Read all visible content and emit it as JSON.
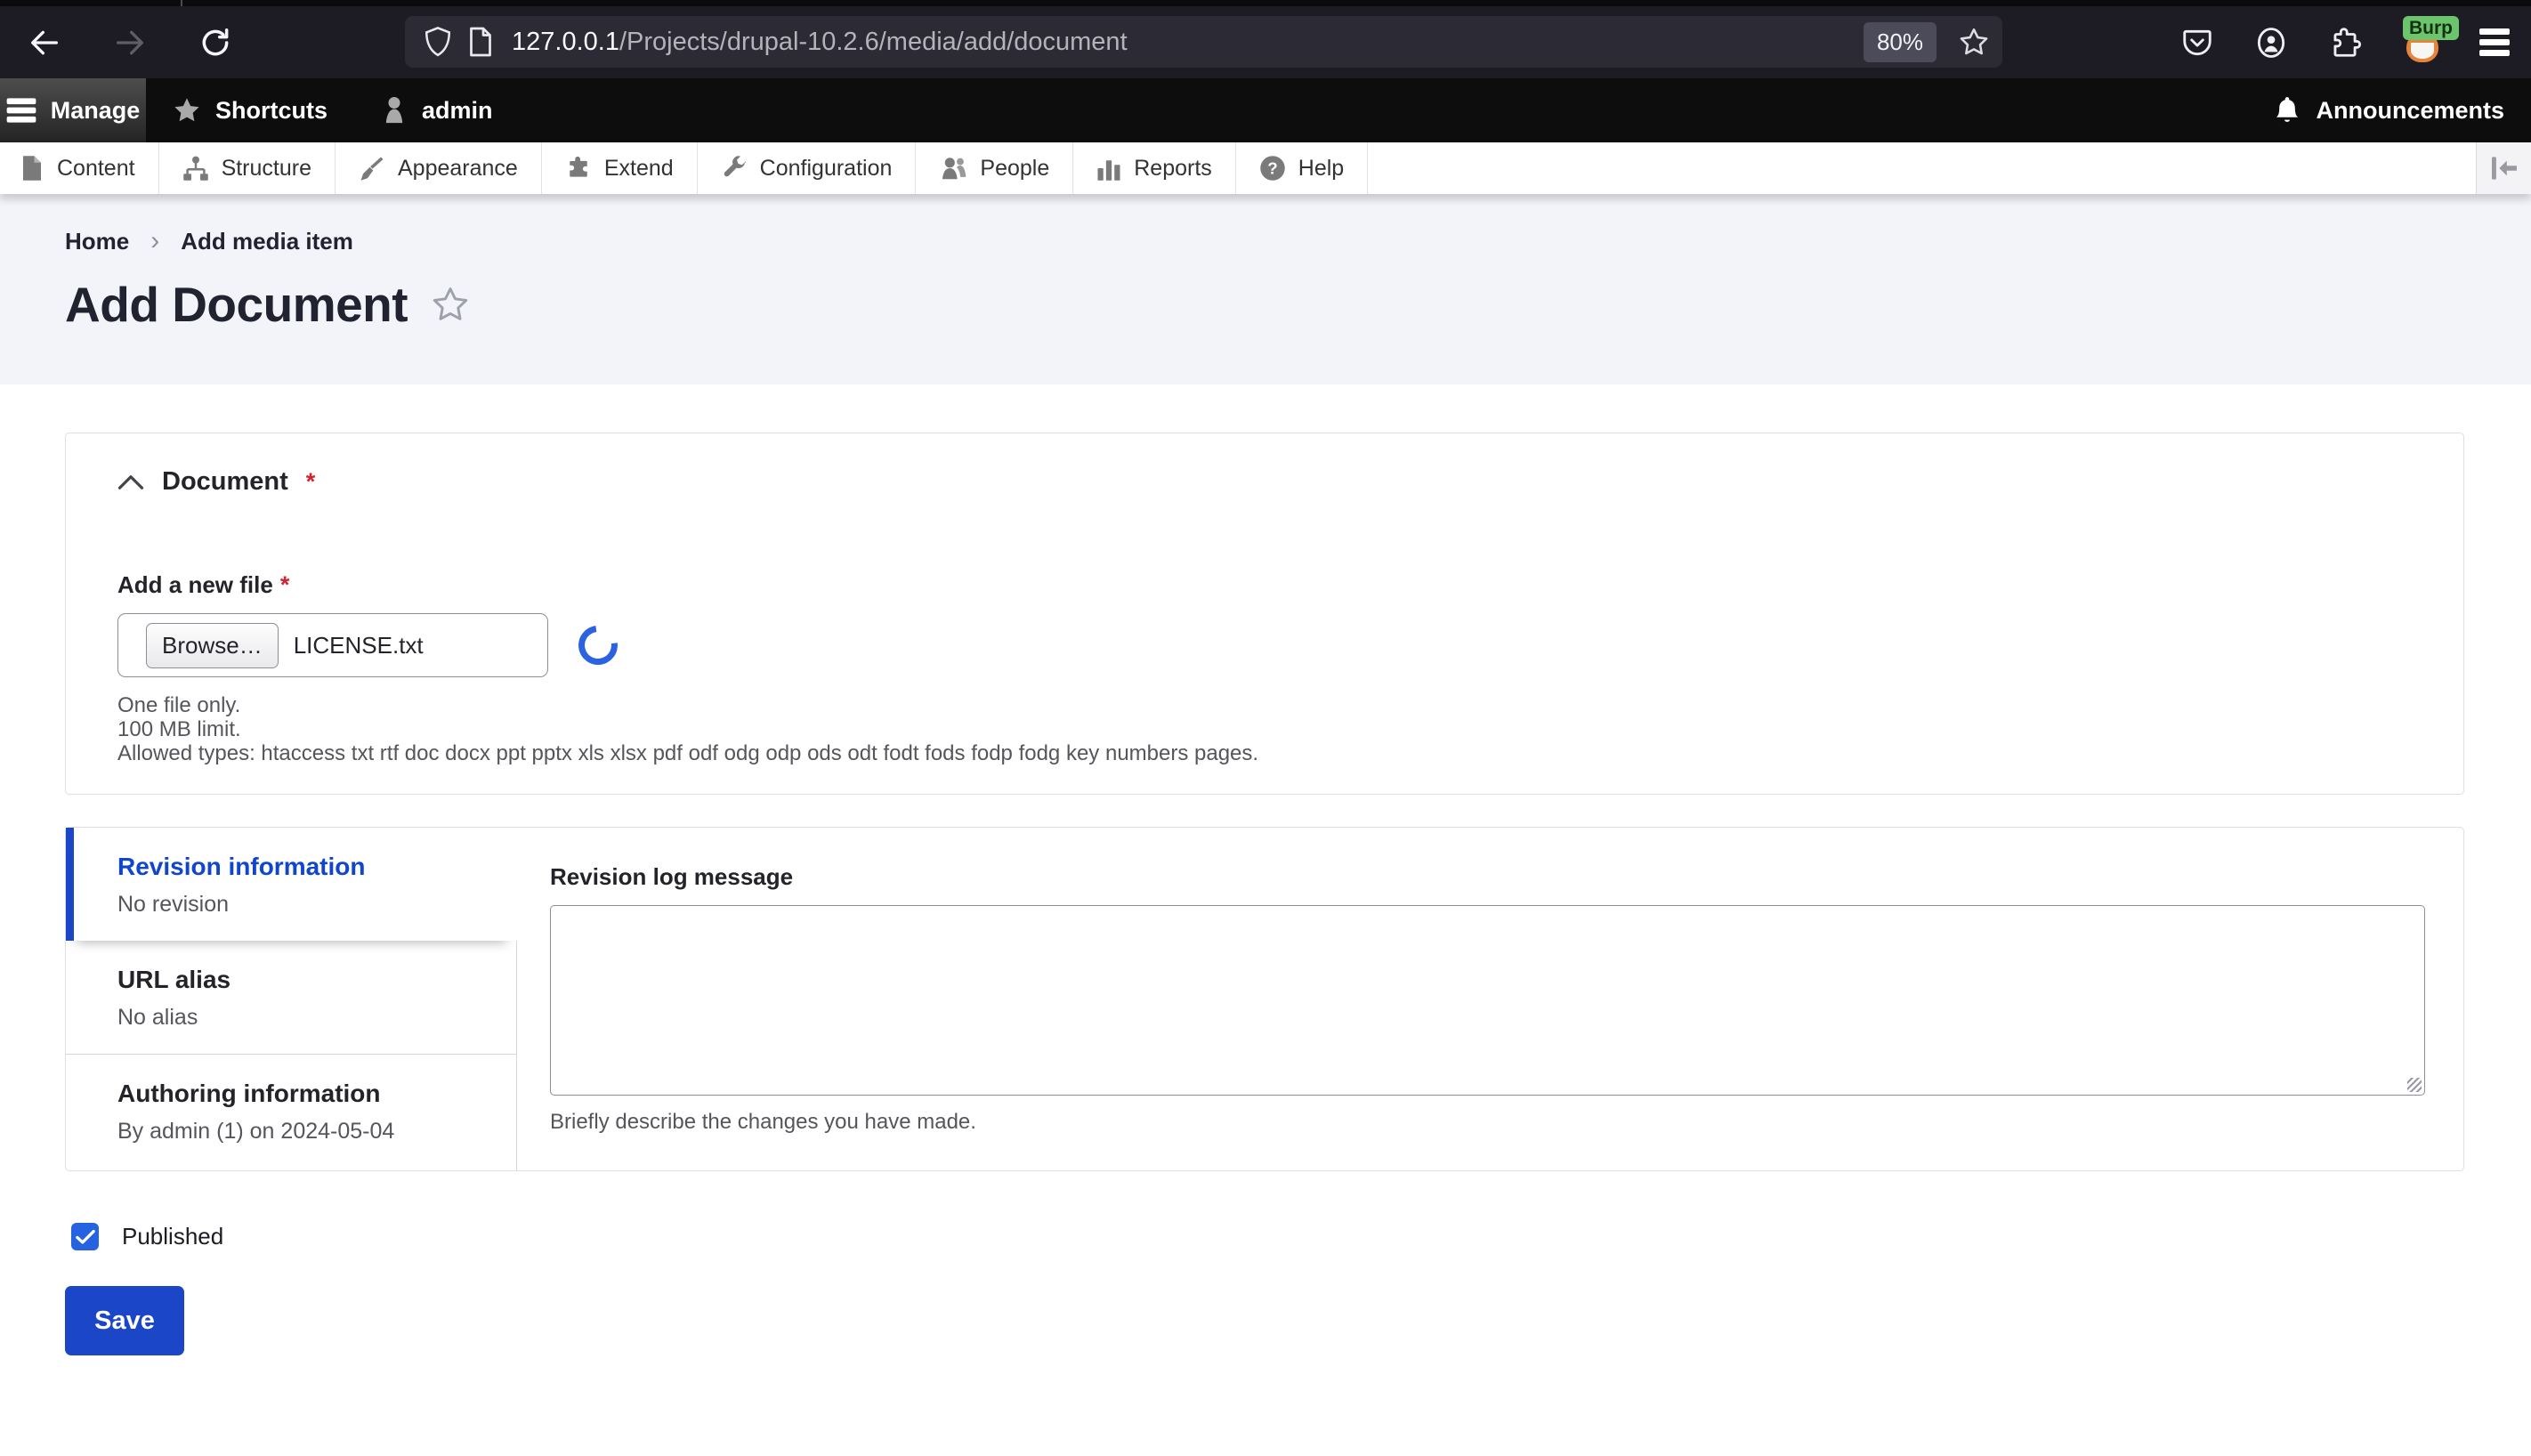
{
  "browser": {
    "url_host": "127.0.0.1",
    "url_path": "/Projects/drupal-10.2.6/media/add/document",
    "zoom_badge": "80%",
    "extension_badge": "Burp"
  },
  "admin_toolbar": {
    "manage": "Manage",
    "shortcuts": "Shortcuts",
    "user": "admin",
    "announcements": "Announcements"
  },
  "menu": {
    "items": [
      {
        "label": "Content",
        "icon": "file-icon"
      },
      {
        "label": "Structure",
        "icon": "sitemap-icon"
      },
      {
        "label": "Appearance",
        "icon": "paintbrush-icon"
      },
      {
        "label": "Extend",
        "icon": "puzzle-icon"
      },
      {
        "label": "Configuration",
        "icon": "wrench-icon"
      },
      {
        "label": "People",
        "icon": "people-icon"
      },
      {
        "label": "Reports",
        "icon": "bar-chart-icon"
      },
      {
        "label": "Help",
        "icon": "question-icon"
      }
    ]
  },
  "breadcrumb": {
    "home": "Home",
    "separator": "›",
    "current": "Add media item"
  },
  "page": {
    "title": "Add Document"
  },
  "document_section": {
    "legend": "Document",
    "required_mark": "*",
    "file_label": "Add a new file",
    "browse_label": "Browse…",
    "file_name": "LICENSE.txt",
    "help": [
      "One file only.",
      "100 MB limit.",
      "Allowed types: htaccess txt rtf doc docx ppt pptx xls xlsx pdf odf odg odp ods odt fodt fods fodp fodg key numbers pages."
    ]
  },
  "vertical_tabs": {
    "tabs": [
      {
        "label": "Revision information",
        "summary": "No revision",
        "active": true
      },
      {
        "label": "URL alias",
        "summary": "No alias",
        "active": false
      },
      {
        "label": "Authoring information",
        "summary": "By admin (1) on 2024-05-04",
        "active": false
      }
    ],
    "panel": {
      "label": "Revision log message",
      "value": "",
      "help": "Briefly describe the changes you have made."
    }
  },
  "publish": {
    "label": "Published",
    "checked": true
  },
  "actions": {
    "save_label": "Save"
  },
  "colors": {
    "accent_blue": "#1b46c8",
    "active_tab_blue": "#0f46cc",
    "checkbox_blue": "#2563e0",
    "spinner_blue": "#2b62e0",
    "required_red": "#d4212d",
    "header_bg": "#f3f4f9",
    "toolbar_black": "#0d0d0d",
    "browser_dark": "#1d1c24"
  }
}
